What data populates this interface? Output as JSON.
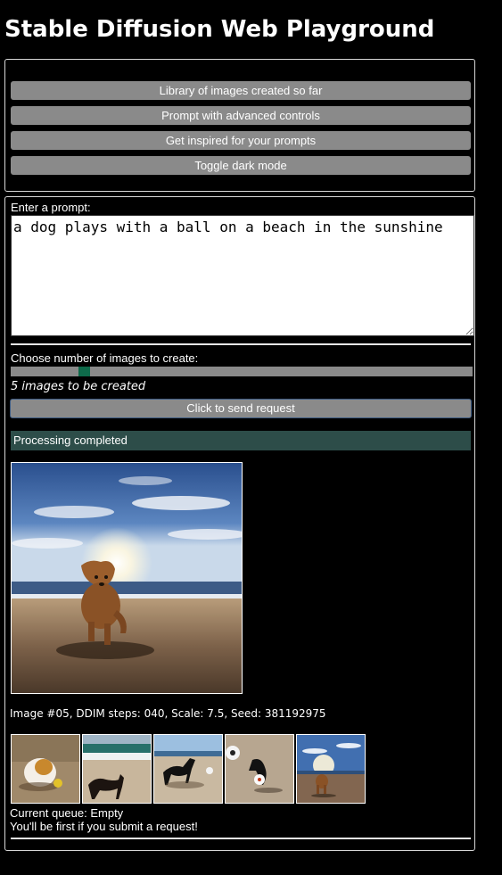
{
  "app": {
    "title": "Stable Diffusion Web Playground"
  },
  "menu": {
    "items": [
      {
        "label": "Library of images created so far"
      },
      {
        "label": "Prompt with advanced controls"
      },
      {
        "label": "Get inspired for your prompts"
      },
      {
        "label": "Toggle dark mode"
      }
    ]
  },
  "prompt": {
    "label": "Enter a prompt:",
    "value": "a dog plays with a ball on a beach in the sunshine"
  },
  "images_count": {
    "label": "Choose number of images to create:",
    "slider_level": 0.15,
    "status": "5 images to be created"
  },
  "send_button": {
    "label": "Click to send request"
  },
  "status_bar": {
    "text": "Processing completed",
    "color": "#2d4d49"
  },
  "result": {
    "caption": "Image #05, DDIM steps: 040, Scale: 7.5, Seed: 381192975",
    "thumbnails": [
      {
        "name": "thumbnail-1"
      },
      {
        "name": "thumbnail-2"
      },
      {
        "name": "thumbnail-3"
      },
      {
        "name": "thumbnail-4"
      },
      {
        "name": "thumbnail-5"
      }
    ]
  },
  "queue": {
    "status": "Current queue: Empty",
    "message": "You'll be first if you submit a request!"
  },
  "colors": {
    "background": "#000000",
    "button": "#8a8a8a",
    "slider_thumb": "#0e6a4a",
    "status_bar": "#2d4d49"
  }
}
